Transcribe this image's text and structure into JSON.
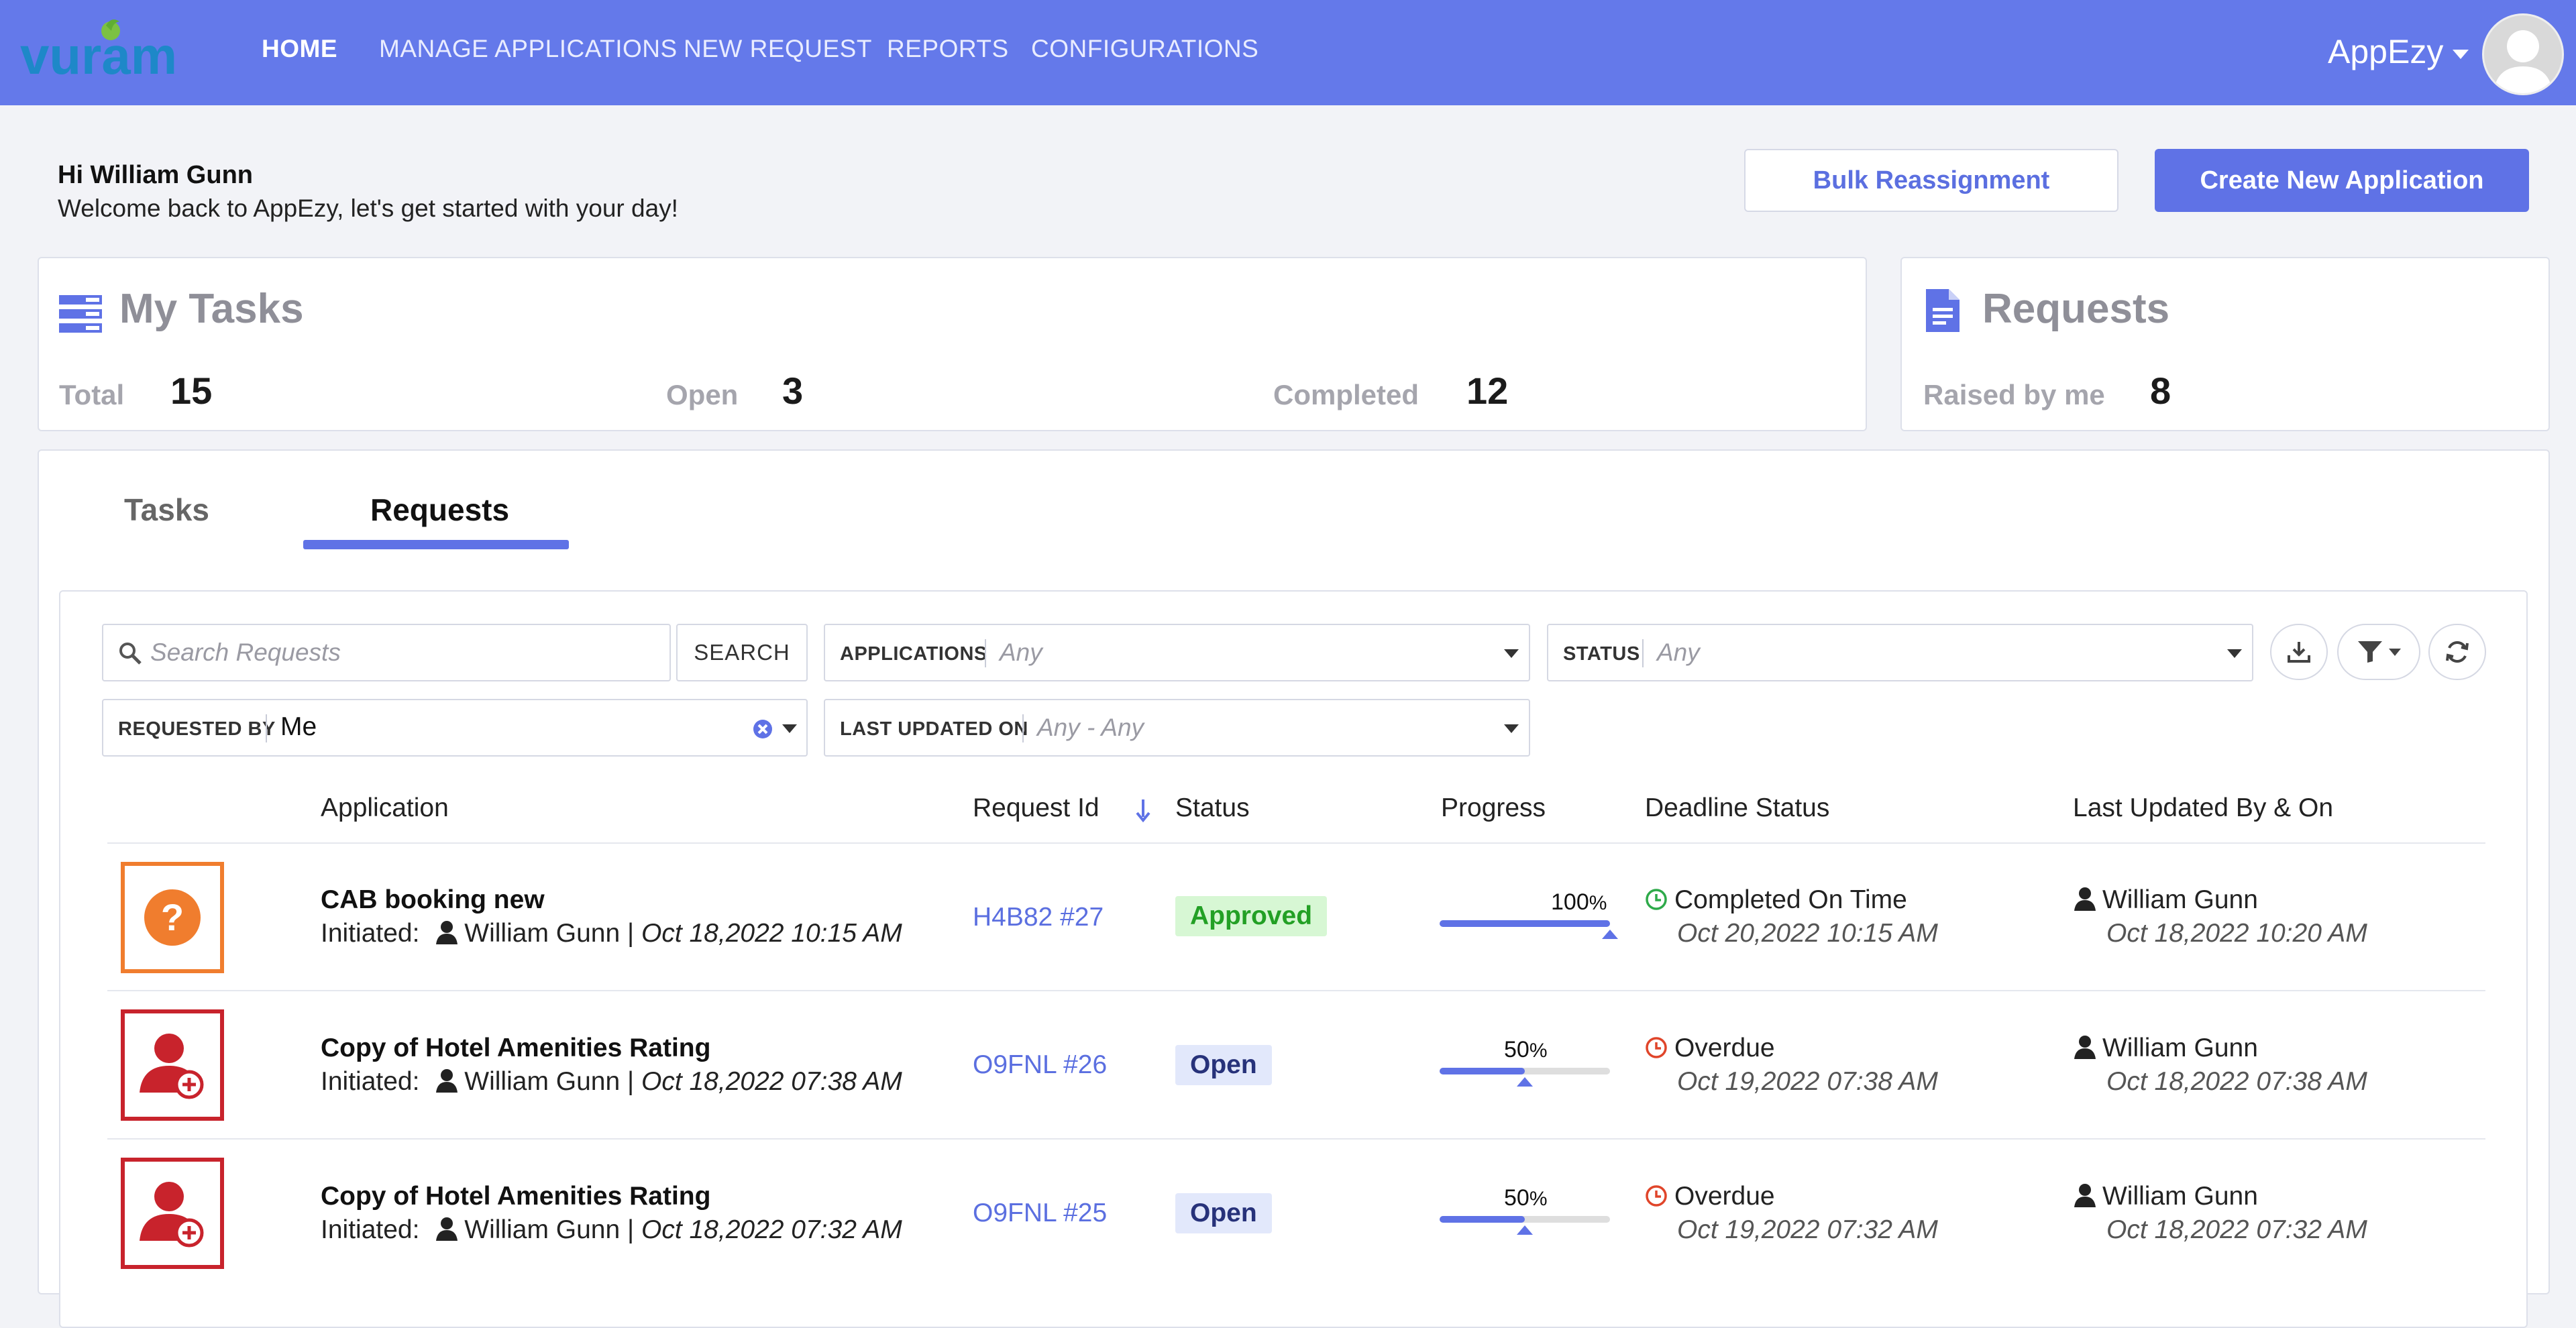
{
  "nav": {
    "logo_text": "vuram",
    "items": [
      "HOME",
      "MANAGE APPLICATIONS",
      "NEW REQUEST",
      "REPORTS",
      "CONFIGURATIONS"
    ],
    "active": "HOME",
    "user_menu": "AppEzy"
  },
  "greeting": {
    "name": "Hi William Gunn",
    "subtitle": "Welcome back to AppEzy, let's get started with your day!"
  },
  "actions": {
    "bulk_reassignment": "Bulk Reassignment",
    "create_new_application": "Create New Application"
  },
  "my_tasks": {
    "title": "My Tasks",
    "total_label": "Total",
    "total_value": "15",
    "open_label": "Open",
    "open_value": "3",
    "completed_label": "Completed",
    "completed_value": "12"
  },
  "requests_card": {
    "title": "Requests",
    "raised_label": "Raised by me",
    "raised_value": "8"
  },
  "tabs": {
    "tasks": "Tasks",
    "requests": "Requests",
    "active": "Requests"
  },
  "filters": {
    "search_placeholder": "Search Requests",
    "search_button": "SEARCH",
    "applications_label": "APPLICATIONS",
    "applications_value": "Any",
    "status_label": "STATUS",
    "status_value": "Any",
    "requested_by_label": "REQUESTED BY",
    "requested_by_value": "Me",
    "last_updated_label": "LAST UPDATED ON",
    "last_updated_value": "Any - Any"
  },
  "table": {
    "headers": {
      "application": "Application",
      "request_id": "Request Id",
      "status": "Status",
      "progress": "Progress",
      "deadline_status": "Deadline Status",
      "last_updated": "Last Updated By & On"
    },
    "initiated_label": "Initiated:",
    "rows": [
      {
        "name": "CAB booking new",
        "initiator": "William Gunn",
        "initiated_on": "Oct 18,2022 10:15 AM",
        "request_id": "H4B82 #27",
        "status": "Approved",
        "progress_pct": "100",
        "progress_suffix": "%",
        "deadline_status": "Completed On Time",
        "deadline_date": "Oct 20,2022 10:15 AM",
        "updated_by": "William Gunn",
        "updated_on": "Oct 18,2022 10:20 AM"
      },
      {
        "name": "Copy of Hotel Amenities Rating",
        "initiator": "William Gunn",
        "initiated_on": "Oct 18,2022 07:38 AM",
        "request_id": "O9FNL #26",
        "status": "Open",
        "progress_pct": "50",
        "progress_suffix": "%",
        "deadline_status": "Overdue",
        "deadline_date": "Oct 19,2022 07:38 AM",
        "updated_by": "William Gunn",
        "updated_on": "Oct 18,2022 07:38 AM"
      },
      {
        "name": "Copy of Hotel Amenities Rating",
        "initiator": "William Gunn",
        "initiated_on": "Oct 18,2022 07:32 AM",
        "request_id": "O9FNL #25",
        "status": "Open",
        "progress_pct": "50",
        "progress_suffix": "%",
        "deadline_status": "Overdue",
        "deadline_date": "Oct 19,2022 07:32 AM",
        "updated_by": "William Gunn",
        "updated_on": "Oct 18,2022 07:32 AM"
      }
    ]
  },
  "colors": {
    "brand": "#6479ea",
    "primary": "#5f72e6",
    "approved": "#23a025",
    "overdue": "#e0452a",
    "on_time": "#2eaa4a",
    "icon_orange": "#f07d2e",
    "icon_red": "#c8232c"
  }
}
